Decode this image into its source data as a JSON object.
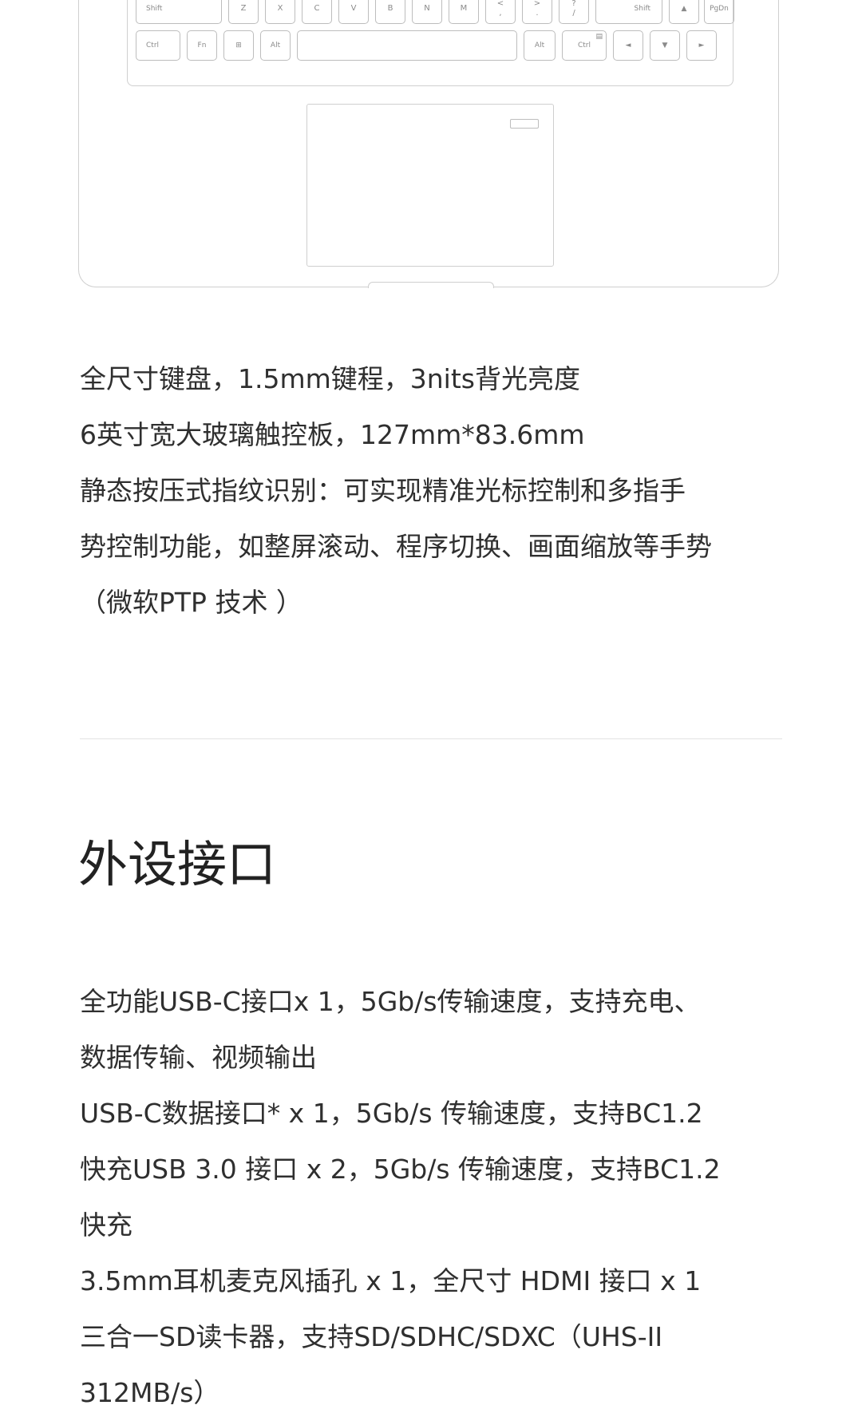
{
  "keyboard": {
    "row_shift": [
      "Shift",
      "Z",
      "X",
      "C",
      "V",
      "B",
      "N",
      "M",
      "<",
      ",",
      ">",
      ".",
      "?",
      "/",
      "Shift",
      "▲",
      "PgDn"
    ],
    "row_bottom": [
      "Ctrl",
      "Fn",
      "⊞",
      "Alt",
      "Alt",
      "Ctrl",
      "▤",
      "◄",
      "▼",
      "►"
    ]
  },
  "features": {
    "lines": [
      "全尺寸键盘，1.5mm键程，3nits背光亮度",
      "6英寸宽大玻璃触控板，127mm*83.6mm",
      "静态按压式指纹识别：可实现精准光标控制和多指手",
      "势控制功能，如整屏滚动、程序切换、画面缩放等手势",
      "（微软PTP 技术 ）"
    ]
  },
  "ports": {
    "title": "外设接口",
    "lines": [
      "全功能USB-C接口x 1，5Gb/s传输速度，支持充电、",
      "数据传输、视频输出",
      "USB-C数据接口* x 1，5Gb/s 传输速度，支持BC1.2",
      "快充USB 3.0 接口 x 2，5Gb/s 传输速度，支持BC1.2",
      "快充",
      "3.5mm耳机麦克风插孔 x 1，全尺寸 HDMI 接口 x 1",
      "三合一SD读卡器，支持SD/SDHC/SDXC（UHS-II",
      "312MB/s）"
    ]
  }
}
